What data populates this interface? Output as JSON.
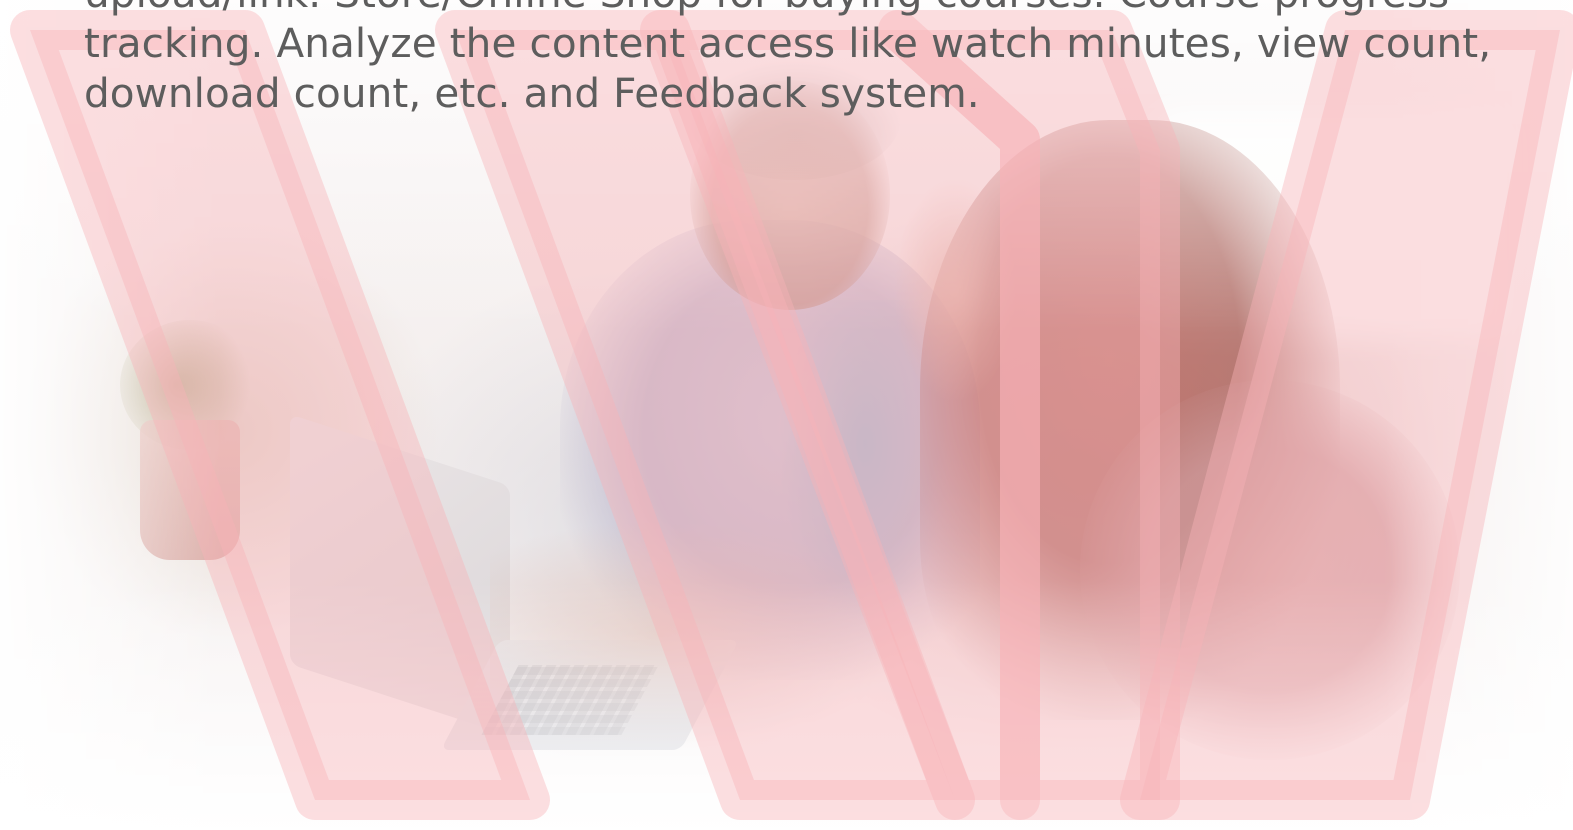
{
  "hero": {
    "description": "upload/link. Store/Online Shop for buying courses. Course progress tracking. Analyze the content access like watch minutes, view count, download count, etc. and Feedback system.",
    "overlay_color": "#f7b2b7",
    "text_color": "#5d5d5d",
    "image_subject": "two people working on a laptop"
  }
}
